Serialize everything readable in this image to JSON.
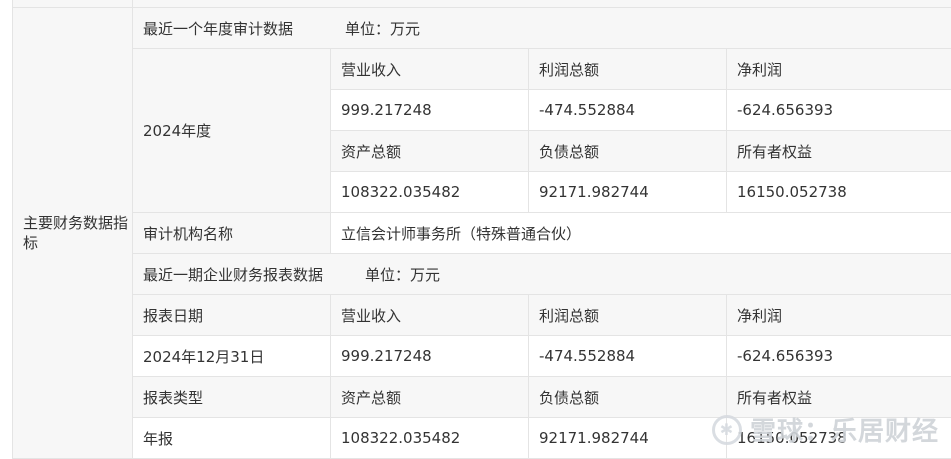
{
  "section_label": "主要财务数据指标",
  "audit": {
    "title": "最近一个年度审计数据",
    "unit": "单位：万元",
    "year": "2024年度",
    "headers1": [
      "营业收入",
      "利润总额",
      "净利润"
    ],
    "values1": [
      "999.217248",
      "-474.552884",
      "-624.656393"
    ],
    "headers2": [
      "资产总额",
      "负债总额",
      "所有者权益"
    ],
    "values2": [
      "108322.035482",
      "92171.982744",
      "16150.052738"
    ],
    "org_label": "审计机构名称",
    "org_value": "立信会计师事务所（特殊普通合伙）"
  },
  "recent": {
    "title": "最近一期企业财务报表数据",
    "unit": "单位：万元",
    "date_label": "报表日期",
    "headers1": [
      "营业收入",
      "利润总额",
      "净利润"
    ],
    "date_value": "2024年12月31日",
    "values1": [
      "999.217248",
      "-474.552884",
      "-624.656393"
    ],
    "type_label": "报表类型",
    "headers2": [
      "资产总额",
      "负债总额",
      "所有者权益"
    ],
    "type_value": "年报",
    "values2": [
      "108322.035482",
      "92171.982744",
      "16150.052738"
    ]
  },
  "watermark": "雪球：乐居财经"
}
